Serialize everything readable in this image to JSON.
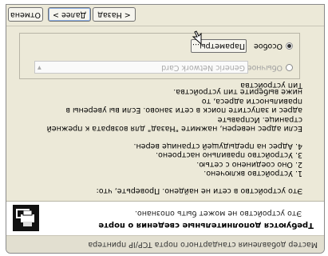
{
  "window": {
    "title": "Мастер добавления стандартного порта TCP/IP принтера"
  },
  "banner": {
    "heading": "Требуются дополнительные сведения о порте",
    "subheading": "Это устройство не может быть опознано."
  },
  "content": {
    "intro": "Это устройство в сети не найдено. Проверьте, что:",
    "checks": [
      "1. Устройство включено.",
      "2. Оно соединено с сетью.",
      "3. Устройство правильно настроено.",
      "4. Адрес на предыдущей странице верен."
    ],
    "advice_lines": [
      "Если адрес неверен, нажмите \"Назад\" для возврата к прежней странице. Исправьте",
      "адрес и запустите поиск в сети заново. Если вы уверены в правильности адреса, то",
      "ниже выберите тип устройства."
    ]
  },
  "device_type": {
    "label": "Тип устройства",
    "standard_label": "Обычное",
    "standard_selected": false,
    "combo_value": "Generic Network Card",
    "custom_label": "Особое",
    "custom_selected": true,
    "params_button": "Параметры..."
  },
  "footer": {
    "back": "< Назад",
    "next": "Далее >",
    "cancel": "Отмена"
  },
  "icons": {
    "banner": "printer-network-icon"
  }
}
